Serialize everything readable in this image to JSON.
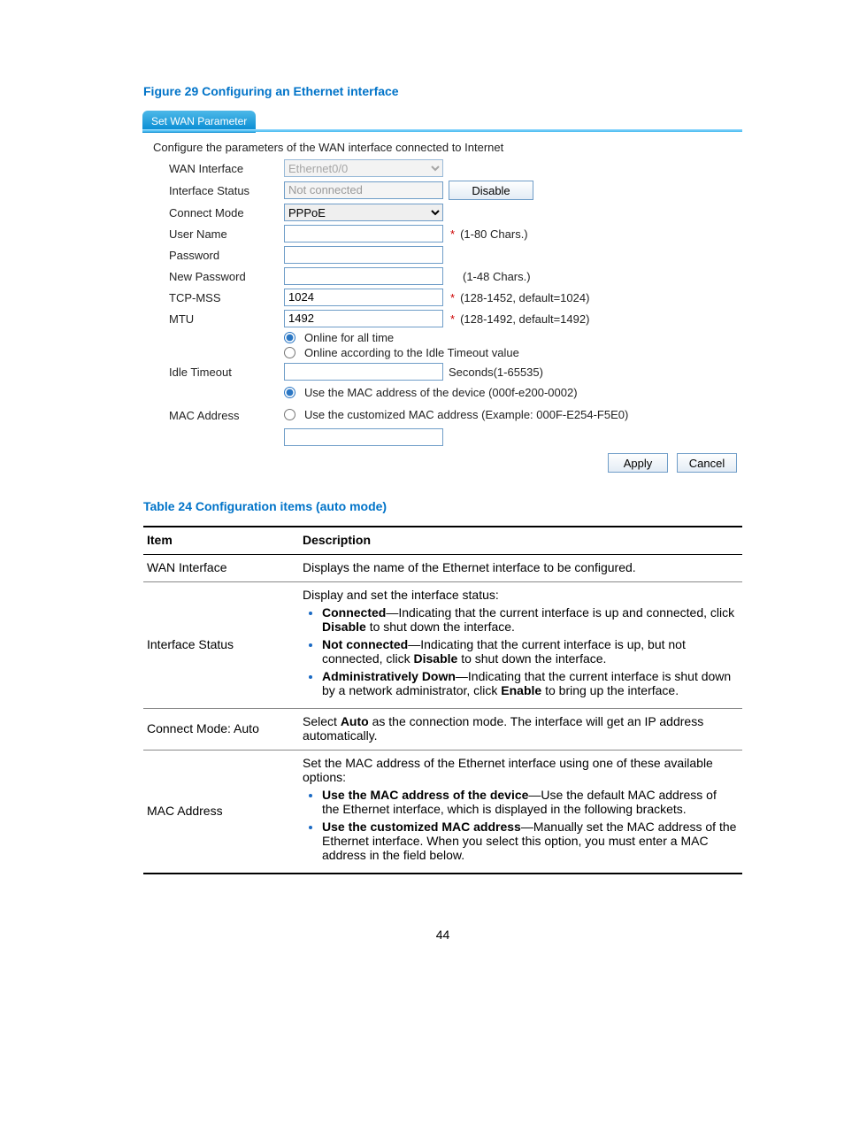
{
  "figure": {
    "title": "Figure 29 Configuring an Ethernet interface"
  },
  "wan": {
    "tab": "Set WAN Parameter",
    "description": "Configure the parameters of the WAN interface connected to Internet",
    "labels": {
      "wan_if": "WAN Interface",
      "if_status": "Interface Status",
      "conn_mode": "Connect Mode",
      "user": "User Name",
      "password": "Password",
      "new_password": "New Password",
      "tcp_mss": "TCP-MSS",
      "mtu": "MTU",
      "idle": "Idle Timeout",
      "mac": "MAC Address"
    },
    "values": {
      "wan_if": "Ethernet0/0",
      "if_status": "Not connected",
      "conn_mode": "PPPoE",
      "user": "",
      "password": "",
      "new_password": "",
      "tcp_mss": "1024",
      "mtu": "1492",
      "idle": "",
      "mac_custom_value": ""
    },
    "hints": {
      "user": "(1-80 Chars.)",
      "new_password": "(1-48 Chars.)",
      "tcp_mss": "(128-1452, default=1024)",
      "mtu": "(128-1492, default=1492)",
      "idle": "Seconds(1-65535)"
    },
    "radios": {
      "online_all": "Online for all time",
      "online_idle": "Online according to the Idle Timeout value",
      "mac_device": "Use the MAC address of the device (000f-e200-0002)",
      "mac_custom": "Use the customized MAC address (Example: 000F-E254-F5E0)"
    },
    "buttons": {
      "disable": "Disable",
      "apply": "Apply",
      "cancel": "Cancel"
    }
  },
  "table": {
    "title": "Table 24 Configuration items (auto mode)",
    "headers": {
      "item": "Item",
      "desc": "Description"
    },
    "rows": {
      "wan_if": {
        "item": "WAN Interface",
        "desc": "Displays the name of the Ethernet interface to be configured."
      },
      "if_status": {
        "item": "Interface Status",
        "intro": "Display and set the interface status:",
        "b_connected": "Connected",
        "t_connected": "—Indicating that the current interface is up and connected, click ",
        "b_disable": "Disable",
        "t_disable_tail": " to shut down the interface.",
        "b_not_connected": "Not connected",
        "t_not_connected": "—Indicating that the current interface is up, but not connected, click ",
        "b_admin_down": "Administratively Down",
        "t_admin_down": "—Indicating that the current interface is shut down by a network administrator, click ",
        "b_enable": "Enable",
        "t_enable_tail": " to bring up the interface."
      },
      "conn_mode": {
        "item": "Connect Mode: Auto",
        "pre": "Select ",
        "b_auto": "Auto",
        "post": " as the connection mode. The interface will get an IP address automatically."
      },
      "mac": {
        "item": "MAC Address",
        "intro": "Set the MAC address of the Ethernet interface using one of these available options:",
        "b_use_device": "Use the MAC address of the device",
        "t_use_device": "—Use the default MAC address of the Ethernet interface, which is displayed in the following brackets.",
        "b_use_custom": "Use the customized MAC address",
        "t_use_custom": "—Manually set the MAC address of the Ethernet interface. When you select this option, you must enter a MAC address in the field below."
      }
    }
  },
  "page_number": "44"
}
